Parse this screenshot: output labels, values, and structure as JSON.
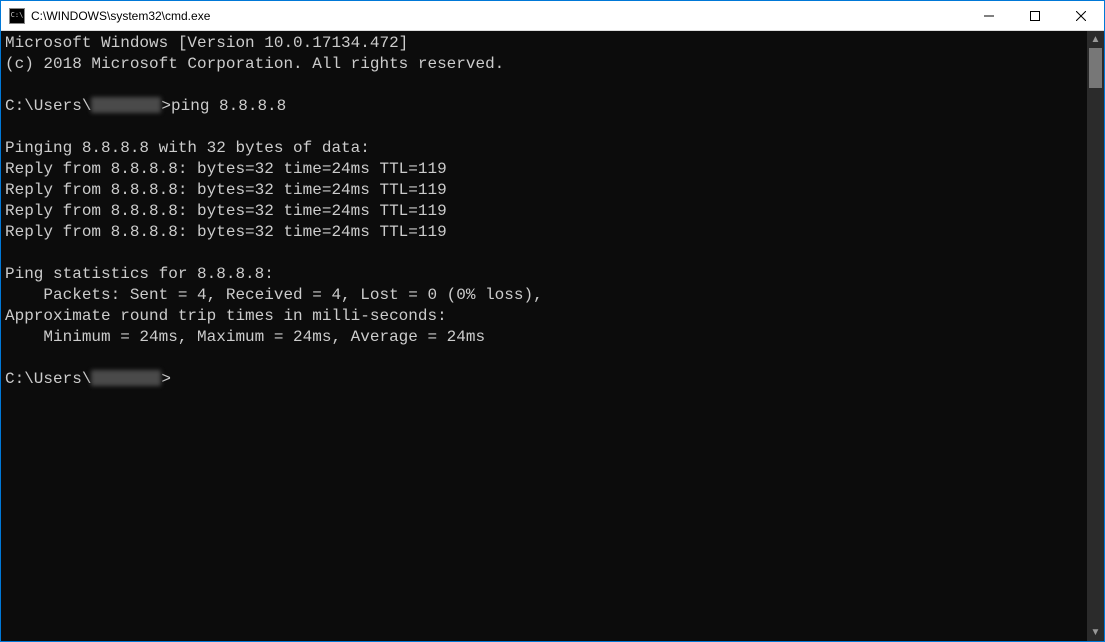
{
  "window": {
    "title": "C:\\WINDOWS\\system32\\cmd.exe"
  },
  "terminal": {
    "header_line1": "Microsoft Windows [Version 10.0.17134.472]",
    "header_line2": "(c) 2018 Microsoft Corporation. All rights reserved.",
    "prompt_prefix": "C:\\Users\\",
    "prompt_suffix_cmd": ">ping 8.8.8.8",
    "ping_header": "Pinging 8.8.8.8 with 32 bytes of data:",
    "reply1": "Reply from 8.8.8.8: bytes=32 time=24ms TTL=119",
    "reply2": "Reply from 8.8.8.8: bytes=32 time=24ms TTL=119",
    "reply3": "Reply from 8.8.8.8: bytes=32 time=24ms TTL=119",
    "reply4": "Reply from 8.8.8.8: bytes=32 time=24ms TTL=119",
    "stats_header": "Ping statistics for 8.8.8.8:",
    "stats_packets": "    Packets: Sent = 4, Received = 4, Lost = 0 (0% loss),",
    "stats_rtt_header": "Approximate round trip times in milli-seconds:",
    "stats_rtt": "    Minimum = 24ms, Maximum = 24ms, Average = 24ms",
    "prompt2_suffix": ">"
  }
}
